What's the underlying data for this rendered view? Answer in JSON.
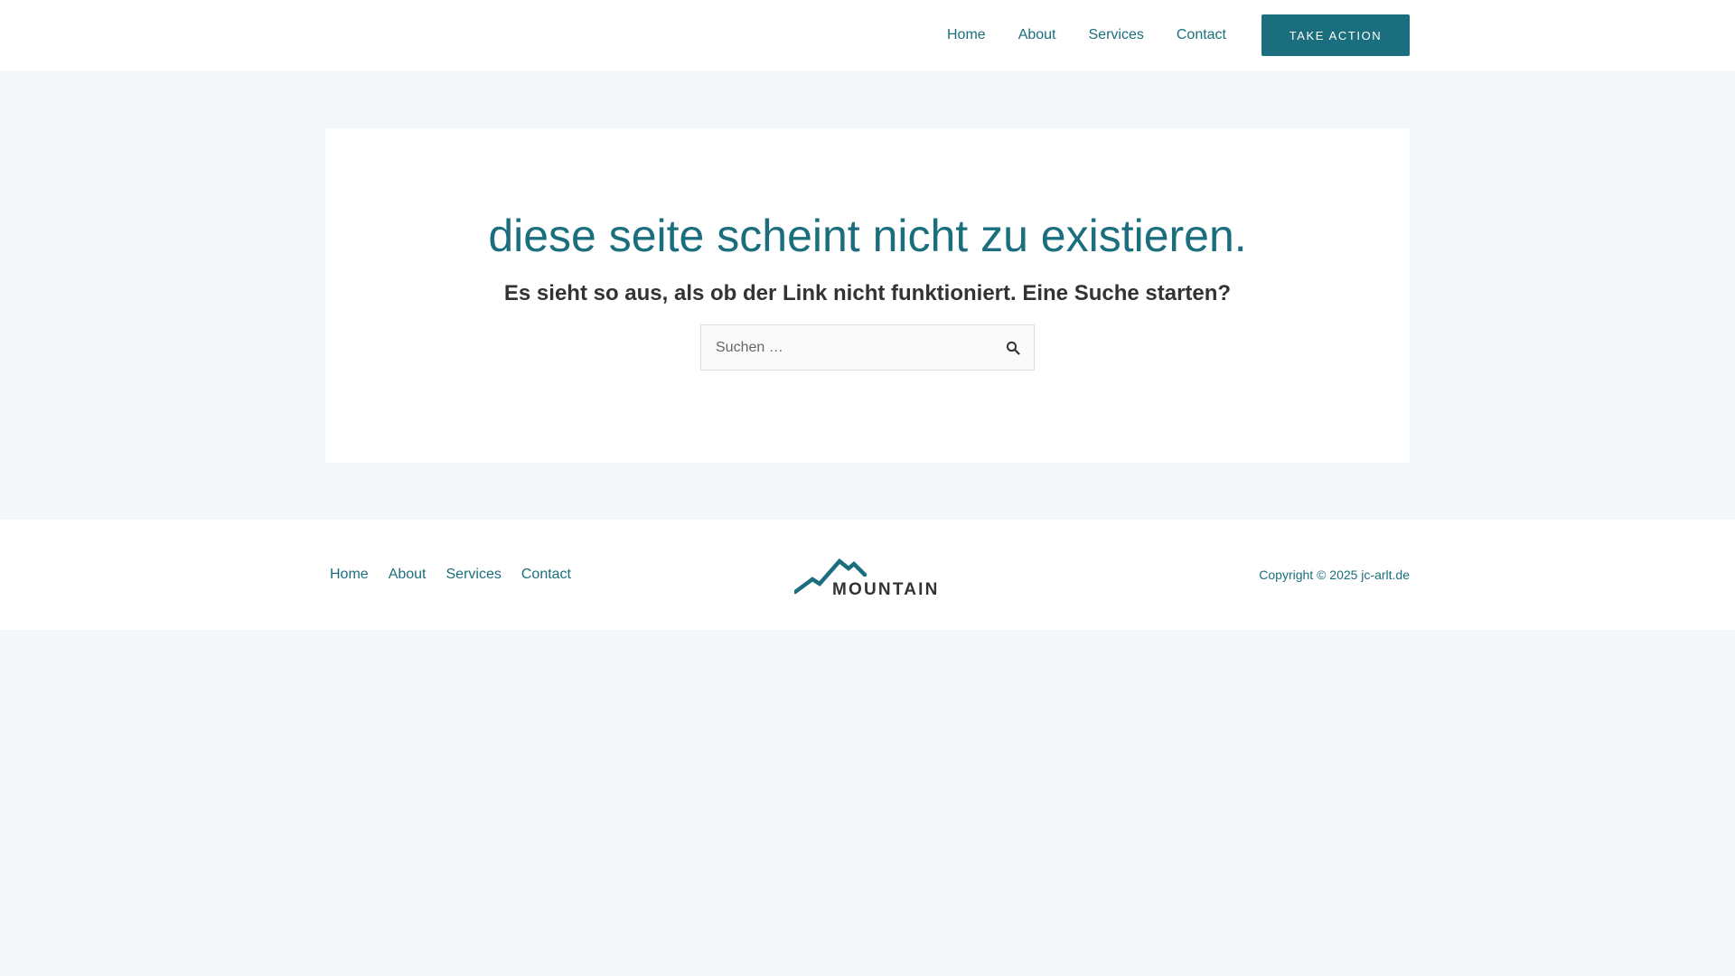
{
  "header": {
    "nav": [
      {
        "label": "Home"
      },
      {
        "label": "About"
      },
      {
        "label": "Services"
      },
      {
        "label": "Contact"
      }
    ],
    "cta_label": "TAKE ACTION"
  },
  "main": {
    "title": "diese seite scheint nicht zu existieren.",
    "subtitle": "Es sieht so aus, als ob der Link nicht funktioniert. Eine Suche starten?",
    "search": {
      "placeholder": "Suchen …",
      "value": "",
      "icon": "search-icon"
    }
  },
  "footer": {
    "nav": [
      {
        "label": "Home"
      },
      {
        "label": "About"
      },
      {
        "label": "Services"
      },
      {
        "label": "Contact"
      }
    ],
    "logo_text": "MOUNTAIN",
    "copyright": "Copyright © 2025 jc-arlt.de"
  },
  "colors": {
    "accent": "#1b6e7d",
    "page_background": "#f3f7fa",
    "text_dark": "#333333"
  }
}
